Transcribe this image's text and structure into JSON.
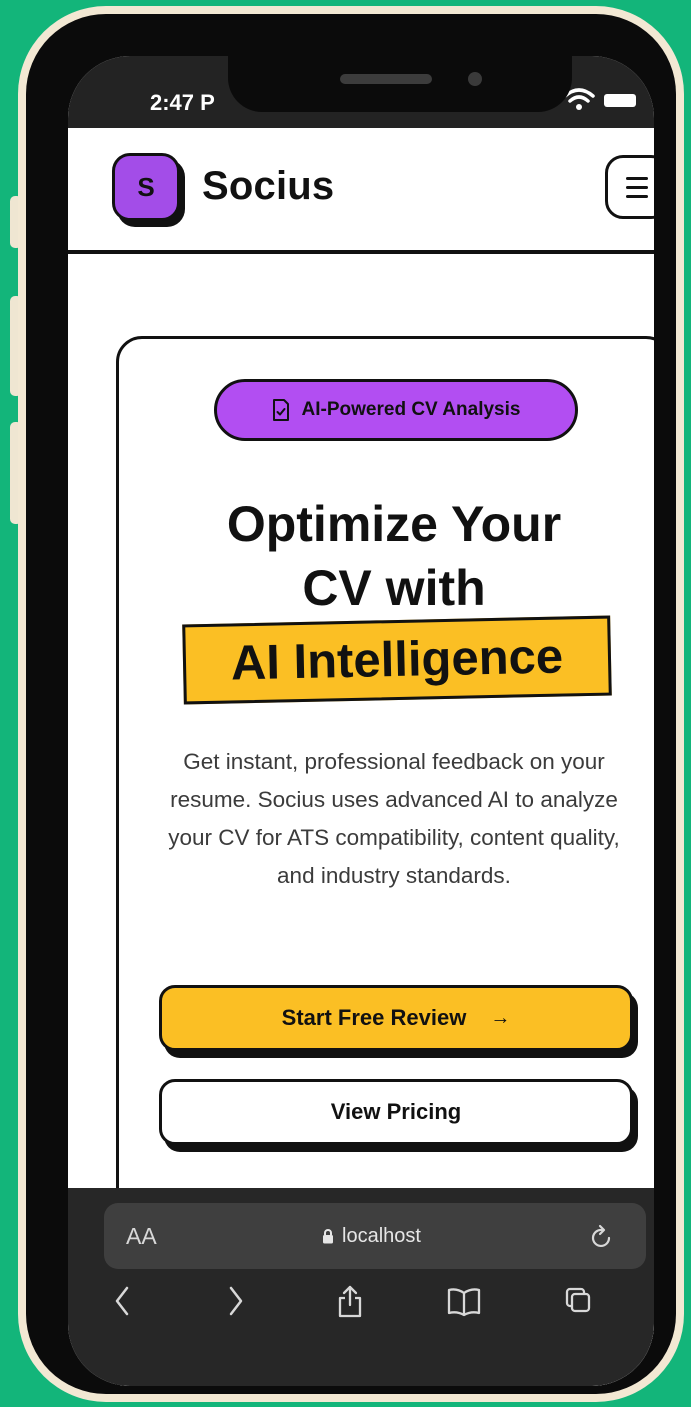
{
  "status_bar": {
    "time": "2:47 P"
  },
  "header": {
    "logo_letter": "S",
    "brand": "Socius"
  },
  "hero": {
    "badge": "AI-Powered CV Analysis",
    "headline_line1": "Optimize Your",
    "headline_line2": "CV with",
    "headline_highlight": "AI Intelligence",
    "description": "Get instant, professional feedback on your resume. Socius uses advanced AI to analyze your CV for ATS compatibility, content quality, and industry standards.",
    "primary_cta": "Start Free Review",
    "primary_cta_arrow": "→",
    "secondary_cta": "View Pricing"
  },
  "browser": {
    "text_size_label": "AA",
    "url": "localhost"
  },
  "colors": {
    "background": "#13b57a",
    "brand_purple": "#a34de8",
    "accent_yellow": "#fbbf24",
    "frame": "#f2e8d3"
  }
}
